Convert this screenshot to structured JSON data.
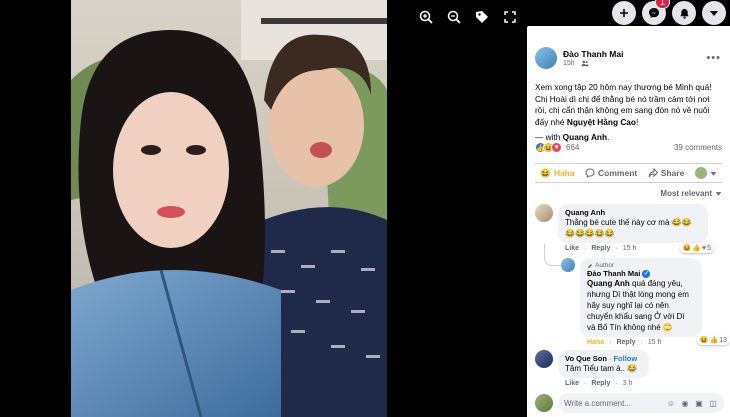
{
  "viewer": {
    "tools": [
      {
        "name": "zoom-in-icon"
      },
      {
        "name": "zoom-out-icon"
      },
      {
        "name": "tag-icon"
      },
      {
        "name": "fullscreen-icon"
      }
    ]
  },
  "top_controls": {
    "messenger_badge": "1"
  },
  "post": {
    "author": "Đào Thanh Mai",
    "time": "15h",
    "text_before": "Xem xong tập 20 hôm nay thương bé Minh quá! Chị Hoài dì chị để thằng bé nó trầm cảm tới nơi rồi, chị cẩn thận không em sang đón nó về nuôi đấy nhé ",
    "text_mention": "Nguyệt Hằng Cao",
    "text_after": "!",
    "with_prefix": "— with ",
    "with_name": "Quang Anh",
    "with_suffix": ".",
    "reaction_count": "664",
    "comments_count": "39 comments",
    "actions": {
      "haha": "Haha",
      "comment": "Comment",
      "share": "Share"
    },
    "sort_label": "Most relevant"
  },
  "comments": [
    {
      "name": "Quang Anh",
      "text": "Thằng bé cute thế này cơ mà 😂😂😂😂😂😂😂",
      "like": "Like",
      "reply": "Reply",
      "time": "15 h",
      "react_count": "5"
    },
    {
      "author_tag": "Author",
      "name": "Đào Thanh Mai",
      "mention": "Quang Anh",
      "text": " quá đáng yêu, nhưng Dì thật lòng mong em hãy suy nghĩ lại có nên chuyển khẩu sang Ở với Dì và Bố Tín không nhé 🙄",
      "like": "Haha",
      "reply": "Reply",
      "time": "15 h",
      "react_count": "13"
    },
    {
      "name": "Vo Que Son",
      "follow": "Follow",
      "text": "Tâm Tiểu tam à.. 😂",
      "like": "Like",
      "reply": "Reply",
      "time": "3 h"
    }
  ],
  "write_comment": {
    "placeholder": "Write a comment..."
  },
  "colors": {
    "accent": "#1877f2",
    "haha": "#f7b125",
    "love": "#f33e58",
    "panel_bg": "#ffffff",
    "bubble_bg": "#f0f2f5"
  }
}
